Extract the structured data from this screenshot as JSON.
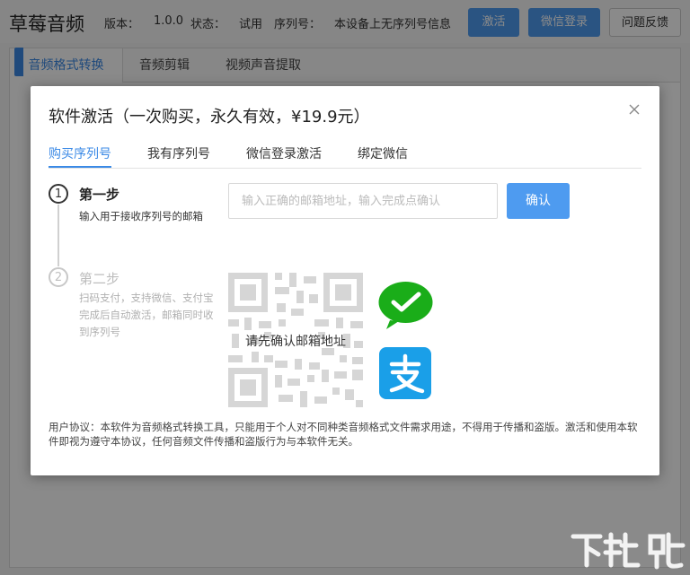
{
  "app": {
    "title": "草莓音频",
    "version_label": "版本：",
    "version_value": "1.0.0",
    "status_label": "状态：",
    "status_value": "试用",
    "serial_label": "序列号：",
    "serial_value": "本设备上无序列号信息",
    "buttons": {
      "activate": "激活",
      "wechat_login": "微信登录",
      "feedback": "问题反馈"
    },
    "tabs": [
      "音频格式转换",
      "音频剪辑",
      "视频声音提取"
    ]
  },
  "modal": {
    "title": "软件激活（一次购买，永久有效，¥19.9元）",
    "tabs": [
      "购买序列号",
      "我有序列号",
      "微信登录激活",
      "绑定微信"
    ],
    "active_tab": 0,
    "steps": [
      {
        "number": "1",
        "title": "第一步",
        "description": [
          "输入用于接收序列号的邮箱"
        ]
      },
      {
        "number": "2",
        "title": "第二步",
        "description": [
          "扫码支付，支持微信、支付宝",
          "完成后自动激活，邮箱同时收",
          "到序列号"
        ]
      }
    ],
    "email": {
      "placeholder": "输入正确的邮箱地址，输入完成点确认",
      "value": ""
    },
    "confirm_button": "确认",
    "qr_overlay_text": "请先确认邮箱地址",
    "payment_icons": [
      "wechat-pay-icon",
      "alipay-icon"
    ],
    "agreement_text": "用户协议：本软件为音频格式转换工具，只能用于个人对不同种类音频格式文件需求用途，不得用于传播和盗版。激活和使用本软件即视为遵守本协议，任何音频文件传播和盗版行为与本软件无关。"
  },
  "colors": {
    "accent": "#4e9bf0",
    "tab_active": "#3b8ae6",
    "wechat_green": "#1aad19",
    "alipay_blue": "#1a9fe8"
  },
  "watermark": "下载吧"
}
